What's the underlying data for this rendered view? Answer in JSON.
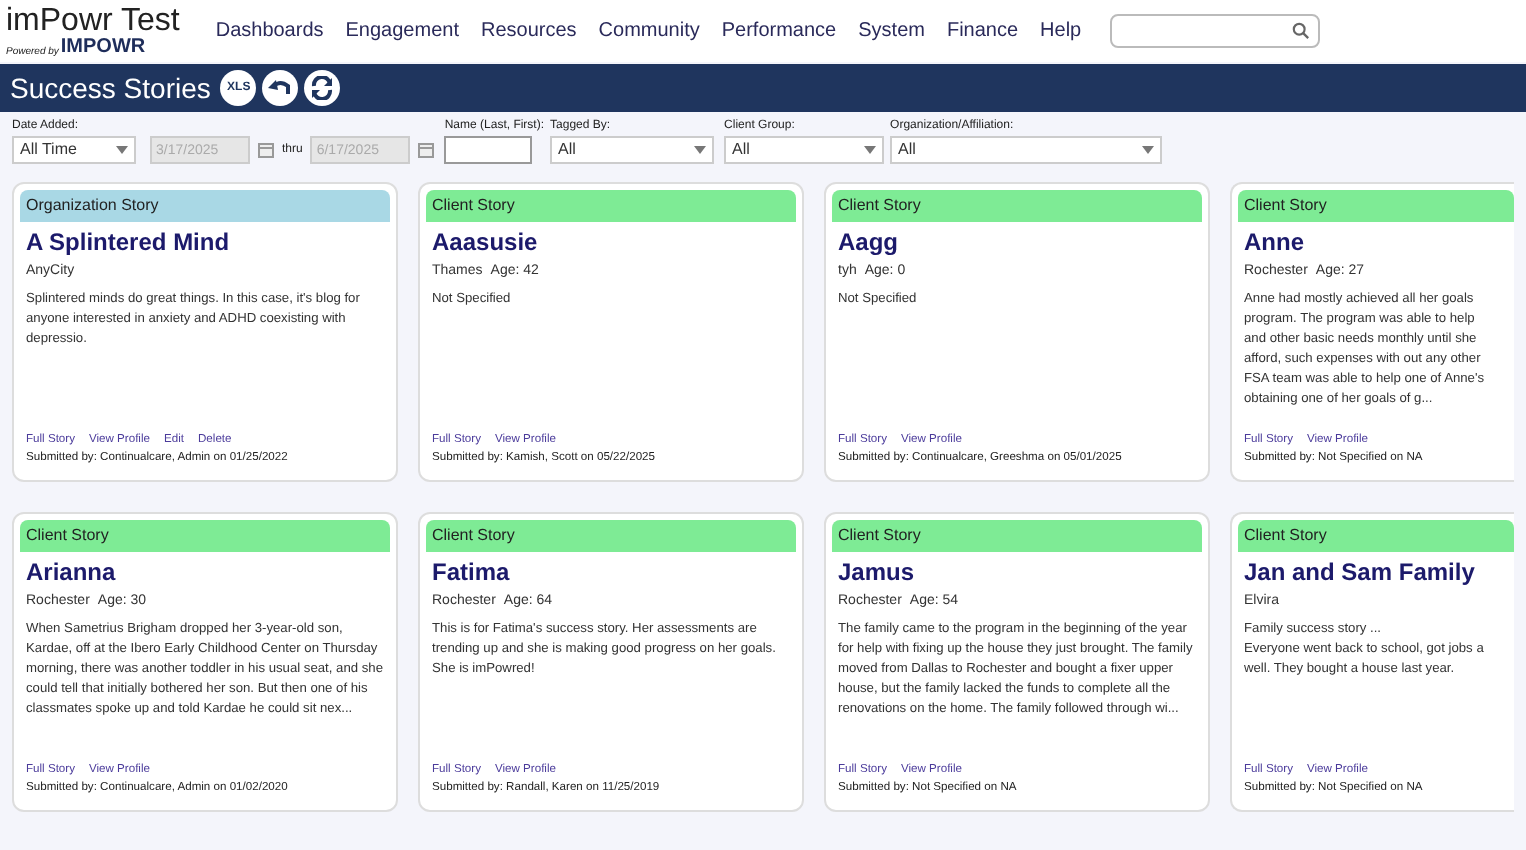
{
  "logo": {
    "title": "imPowr Test",
    "powered_by": "Powered by",
    "brand": "IMPOWR"
  },
  "nav": [
    "Dashboards",
    "Engagement",
    "Resources",
    "Community",
    "Performance",
    "System",
    "Finance",
    "Help"
  ],
  "page_title": "Success Stories",
  "toolbar": [
    {
      "kind": "xls",
      "label": "XLS"
    },
    {
      "kind": "undo"
    },
    {
      "kind": "refresh"
    }
  ],
  "filters": {
    "date_added": {
      "label": "Date Added:",
      "value": "All Time",
      "from": "3/17/2025",
      "thru": "thru",
      "to": "6/17/2025",
      "disabled": true
    },
    "name": {
      "label": "Name (Last, First):"
    },
    "tagged_by": {
      "label": "Tagged By:",
      "value": "All"
    },
    "client_group": {
      "label": "Client Group:",
      "value": "All"
    },
    "organization": {
      "label": "Organization/Affiliation:",
      "value": "All"
    }
  },
  "stories": [
    {
      "kind": "organization",
      "type_label": "Organization Story",
      "name": "A Splintered Mind",
      "location": "AnyCity",
      "text": "Splintered minds do great things. In this case, it's blog for anyone interested in anxiety and ADHD coexisting with depressio.",
      "links": [
        "Full Story",
        "View Profile",
        "Edit",
        "Delete"
      ],
      "submitted": "Submitted by: Continualcare, Admin on 01/25/2022"
    },
    {
      "kind": "client",
      "type_label": "Client Story",
      "name": "Aaasusie",
      "location": "Thames",
      "age": "Age: 42",
      "text": "Not Specified",
      "links": [
        "Full Story",
        "View Profile"
      ],
      "submitted": "Submitted by: Kamish, Scott on 05/22/2025"
    },
    {
      "kind": "client",
      "type_label": "Client Story",
      "name": "Aagg",
      "location": "tyh",
      "age": "Age: 0",
      "text": "Not Specified",
      "links": [
        "Full Story",
        "View Profile"
      ],
      "submitted": "Submitted by: Continualcare, Greeshma on 05/01/2025"
    },
    {
      "kind": "client",
      "type_label": "Client Story",
      "name": "Anne",
      "location": "Rochester",
      "age": "Age: 27",
      "text": "Anne had mostly achieved all her goals\nprogram. The program was able to help\nand other basic needs monthly until she\nafford, such expenses with out any other\nFSA team was able to help one of Anne's\nobtaining one of her goals of g...",
      "links": [
        "Full Story",
        "View Profile"
      ],
      "submitted": "Submitted by: Not Specified on NA"
    },
    {
      "kind": "client",
      "type_label": "Client Story",
      "name": "Arianna",
      "location": "Rochester",
      "age": "Age: 30",
      "text": "When Sametrius Brigham dropped her 3-year-old son, Kardae, off at the Ibero Early Childhood Center on Thursday morning, there was another toddler in his usual seat, and she could tell that initially bothered her son. But then one of his classmates spoke up and told Kardae he could sit nex...",
      "links": [
        "Full Story",
        "View Profile"
      ],
      "submitted": "Submitted by: Continualcare, Admin on 01/02/2020"
    },
    {
      "kind": "client",
      "type_label": "Client Story",
      "name": "Fatima",
      "location": "Rochester",
      "age": "Age: 64",
      "text": "This is for Fatima's success story.  Her assessments are trending up and she is making good progress on her goals.  She is imPowred!",
      "links": [
        "Full Story",
        "View Profile"
      ],
      "submitted": "Submitted by: Randall, Karen on 11/25/2019"
    },
    {
      "kind": "client",
      "type_label": "Client Story",
      "name": "Jamus",
      "location": "Rochester",
      "age": "Age: 54",
      "text": "The family came to the program in the beginning of the year for help with fixing up the house they just brought. The family moved from Dallas to Rochester and bought a fixer upper house, but the family lacked the funds to complete all the renovations on the home. The family followed through wi...",
      "links": [
        "Full Story",
        "View Profile"
      ],
      "submitted": "Submitted by: Not Specified on NA"
    },
    {
      "kind": "client",
      "type_label": "Client Story",
      "name": "Jan and Sam Family",
      "location": "Elvira",
      "text": "Family success story ...\nEveryone went back to school, got jobs a\nwell. They bought a house last year.",
      "links": [
        "Full Story",
        "View Profile"
      ],
      "submitted": "Submitted by: Not Specified on NA"
    }
  ]
}
